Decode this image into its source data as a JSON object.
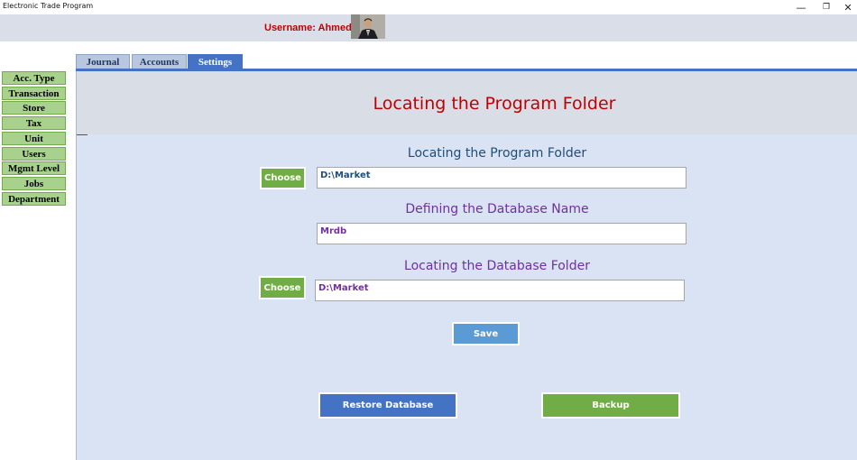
{
  "window": {
    "title": "Electronic Trade Program",
    "controls": {
      "minimize": "—",
      "maximize": "❐",
      "close": "✕"
    }
  },
  "header": {
    "username_text": "Username: Ahmed",
    "avatar_icon": "user-photo-icon"
  },
  "tabs": [
    {
      "label": "Journal",
      "active": false
    },
    {
      "label": "Accounts",
      "active": false
    },
    {
      "label": "Settings",
      "active": true
    }
  ],
  "sidebar": {
    "items": [
      {
        "label": "Acc. Type"
      },
      {
        "label": "Transaction"
      },
      {
        "label": "Store"
      },
      {
        "label": "Tax"
      },
      {
        "label": "Unit"
      },
      {
        "label": "Users"
      },
      {
        "label": "Mgmt Level"
      },
      {
        "label": "Jobs"
      },
      {
        "label": "Department"
      }
    ]
  },
  "main": {
    "banner_title": "Locating the Program Folder",
    "program_folder": {
      "heading": "Locating the Program Folder",
      "button_label": "Choose",
      "value": "D:\\Market"
    },
    "database_name": {
      "heading": "Defining the Database Name",
      "value": "Mrdb"
    },
    "database_folder": {
      "heading": "Locating the Database Folder",
      "button_label": "Choose",
      "value": "D:\\Market"
    },
    "save_label": "Save",
    "restore_label": "Restore Database",
    "backup_label": "Backup"
  },
  "colors": {
    "accent_blue": "#4472c4",
    "sidebar_green": "#a9d18e",
    "button_green": "#70ad47",
    "save_blue": "#5b9bd5",
    "title_red": "#c00000",
    "heading_navy": "#1f4e79",
    "heading_purple": "#7030a0",
    "panel_bg": "#dae3f3"
  }
}
